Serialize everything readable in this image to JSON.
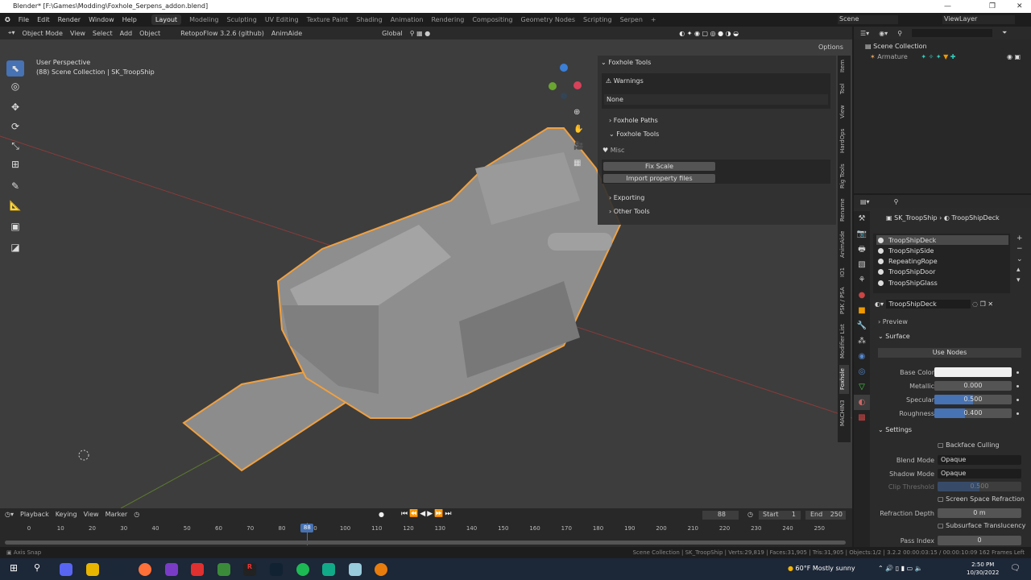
{
  "title": "Blender* [F:\\Games\\Modding\\Foxhole_Serpens_addon.blend]",
  "window_controls": {
    "minimize": "—",
    "restore": "❐",
    "close": "✕"
  },
  "menu": [
    "File",
    "Edit",
    "Render",
    "Window",
    "Help"
  ],
  "workspaces": [
    "Layout",
    "Modeling",
    "Sculpting",
    "UV Editing",
    "Texture Paint",
    "Shading",
    "Animation",
    "Rendering",
    "Compositing",
    "Geometry Nodes",
    "Scripting",
    "Serpen",
    "+"
  ],
  "scene": "Scene",
  "view_layer": "ViewLayer",
  "viewport_header": {
    "mode": "Object Mode",
    "items": [
      "View",
      "Select",
      "Add",
      "Object"
    ],
    "retopoflow": "RetopoFlow 3.2.6 (github)",
    "animaide": "AnimAide",
    "orientation": "Global",
    "options": "Options"
  },
  "viewport": {
    "perspective": "User Perspective",
    "collection": "(88) Scene Collection | SK_TroopShip"
  },
  "npanel": {
    "header": "Foxhole Tools",
    "warnings": "Warnings",
    "warnings_value": "None",
    "paths": "Foxhole Paths",
    "tools": "Foxhole Tools",
    "misc": "Misc",
    "fix_scale": "Fix Scale",
    "import_props": "Import property files",
    "exporting": "Exporting",
    "other_tools": "Other Tools"
  },
  "side_tabs": [
    "Item",
    "Tool",
    "View",
    "HardOps",
    "Rig Tools",
    "Rename",
    "AnimAide",
    "IO1",
    "PSK / PSA",
    "Modifier List",
    "Foxhole",
    "MACHIN3"
  ],
  "outliner": {
    "root": "Scene Collection",
    "items": [
      "Armature"
    ]
  },
  "properties": {
    "breadcrumb_object": "SK_TroopShip",
    "breadcrumb_material": "TroopShipDeck",
    "materials": [
      "TroopShipDeck",
      "TroopShipSide",
      "RepeatingRope",
      "TroopShipDoor",
      "TroopShipGlass"
    ],
    "active_material": "TroopShipDeck",
    "preview": "Preview",
    "surface": "Surface",
    "use_nodes": "Use Nodes",
    "base_color_label": "Base Color",
    "base_color": "#f0f0f0",
    "metallic_label": "Metallic",
    "metallic": "0.000",
    "specular_label": "Specular",
    "specular": "0.500",
    "specular_fraction": 0.5,
    "roughness_label": "Roughness",
    "roughness": "0.400",
    "roughness_fraction": 0.4,
    "settings": "Settings",
    "backface": "Backface Culling",
    "blend_label": "Blend Mode",
    "blend": "Opaque",
    "shadow_label": "Shadow Mode",
    "shadow": "Opaque",
    "clip_label": "Clip Threshold",
    "clip": "0.500",
    "ssr": "Screen Space Refraction",
    "refraction_label": "Refraction Depth",
    "refraction": "0 m",
    "subsurface": "Subsurface Translucency",
    "pass_label": "Pass Index",
    "pass": "0"
  },
  "timeline": {
    "menus": [
      "Playback",
      "Keying",
      "View",
      "Marker"
    ],
    "current": "88",
    "start_label": "Start",
    "start": "1",
    "end_label": "End",
    "end": "250",
    "ticks": [
      "0",
      "10",
      "20",
      "30",
      "40",
      "50",
      "60",
      "70",
      "80",
      "90",
      "100",
      "110",
      "120",
      "130",
      "140",
      "150",
      "160",
      "170",
      "180",
      "190",
      "200",
      "210",
      "220",
      "230",
      "240",
      "250"
    ]
  },
  "status": {
    "left": "Axis Snap",
    "right": "Scene Collection | SK_TroopShip | Verts:29,819 | Faces:31,905 | Tris:31,905 | Objects:1/2 | 3.2.2  00:00:03:15 / 00:00:10:09  162 Frames Left"
  },
  "taskbar": {
    "weather": "60°F  Mostly sunny",
    "time": "2:50 PM",
    "date": "10/30/2022"
  },
  "colors": {
    "accent": "#4772b3",
    "selection": "#f5a040"
  }
}
